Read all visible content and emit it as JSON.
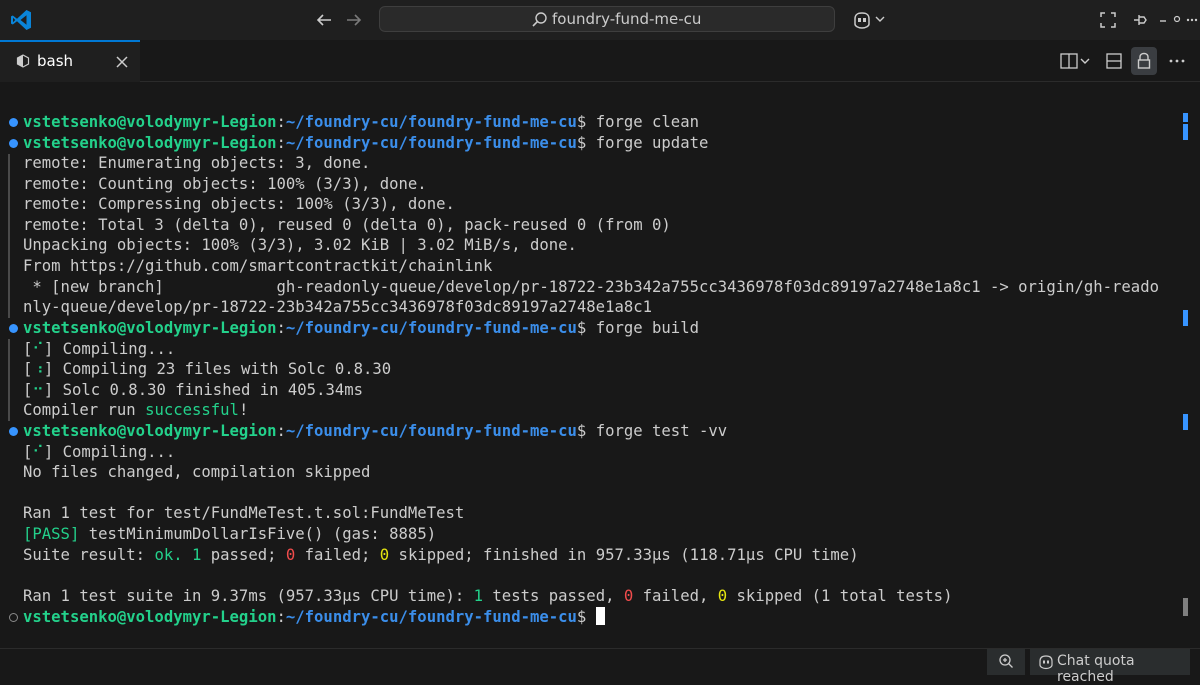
{
  "window": {
    "search_text": "foundry-fund-me-cu",
    "tab_label": "bash"
  },
  "terminal": {
    "user_host": "vstetsenko@volodymyr-Legion",
    "colon": ":",
    "path": "~/foundry-cu/foundry-fund-me-cu",
    "prompt_char": "$",
    "cmd1": " forge clean",
    "cmd2": " forge update",
    "cmd3": " forge build",
    "cmd4": " forge test -vv",
    "out_update": [
      "remote: Enumerating objects: 3, done.",
      "remote: Counting objects: 100% (3/3), done.",
      "remote: Compressing objects: 100% (3/3), done.",
      "remote: Total 3 (delta 0), reused 0 (delta 0), pack-reused 0 (from 0)",
      "Unpacking objects: 100% (3/3), 3.02 KiB | 3.02 MiB/s, done.",
      "From https://github.com/smartcontractkit/chainlink",
      " * [new branch]            gh-readonly-queue/develop/pr-18722-23b342a755cc3436978f03dc89197a2748e1a8c1 -> origin/gh-reado",
      "nly-queue/develop/pr-18722-23b342a755cc3436978f03dc89197a2748e1a8c1"
    ],
    "build": {
      "spin1_open": "[",
      "spin1_glyph": "⠊",
      "spin1_rest": "] Compiling...",
      "spin2_open": "[",
      "spin2_glyph": "⠰",
      "spin2_rest": "] Compiling 23 files with Solc 0.8.30",
      "spin3_open": "[",
      "spin3_glyph": "⠒",
      "spin3_rest": "] Solc 0.8.30 finished in 405.34ms",
      "run_prefix": "Compiler run ",
      "run_success": "successful",
      "run_suffix": "!"
    },
    "test": {
      "spin_open": "[",
      "spin_glyph": "⠊",
      "spin_rest": "] Compiling...",
      "no_change": "No files changed, compilation skipped",
      "ran": "Ran 1 test for test/FundMeTest.t.sol:FundMeTest",
      "pass_tag": "[PASS]",
      "pass_rest": " testMinimumDollarIsFive() (gas: 8885)",
      "suite_a": "Suite result: ",
      "suite_ok": "ok.",
      "suite_b": " ",
      "suite_passed_n": "1",
      "suite_c": " passed; ",
      "suite_failed_n": "0",
      "suite_d": " failed; ",
      "suite_skipped_n": "0",
      "suite_e": " skipped; finished in 957.33µs (118.71µs CPU time)",
      "sum_a": "Ran 1 test suite in 9.37ms (957.33µs CPU time): ",
      "sum_passed_n": "1",
      "sum_b": " tests passed, ",
      "sum_failed_n": "0",
      "sum_c": " failed, ",
      "sum_skipped_n": "0",
      "sum_d": " skipped (1 total tests)"
    }
  },
  "status": {
    "chat_quota": "Chat quota reached"
  },
  "colors": {
    "accent": "#0078d4",
    "user_green": "#23d18b",
    "path_blue": "#3b8eea",
    "fail_red": "#f14c4c",
    "skip_yellow": "#e5e510"
  }
}
